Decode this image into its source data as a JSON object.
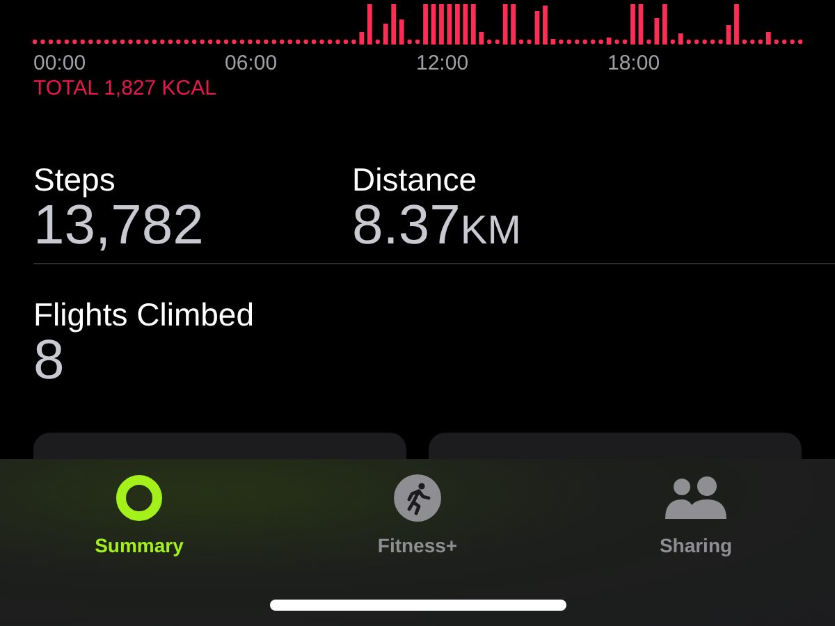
{
  "chart": {
    "time_labels": [
      "00:00",
      "06:00",
      "12:00",
      "18:00"
    ],
    "total": "TOTAL 1,827 KCAL"
  },
  "metrics": [
    {
      "label": "Steps",
      "value": "13,782"
    },
    {
      "label": "Distance",
      "value": "8.37",
      "unit": "KM"
    },
    {
      "label": "Flights Climbed",
      "value": "8"
    }
  ],
  "tabs": [
    {
      "label": "Summary",
      "kind": "ring",
      "selected": true
    },
    {
      "label": "Fitness+",
      "kind": "runner",
      "selected": false
    },
    {
      "label": "Sharing",
      "kind": "people",
      "selected": false
    }
  ]
}
